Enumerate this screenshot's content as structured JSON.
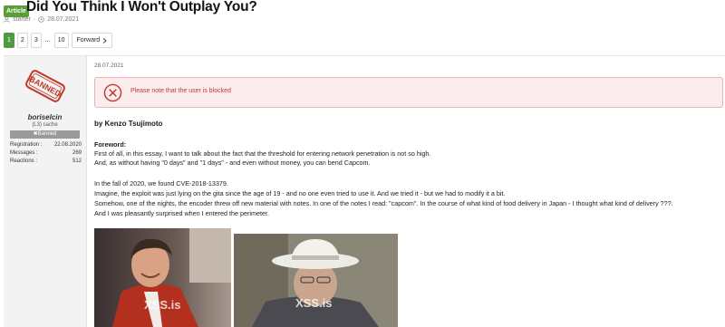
{
  "thread": {
    "badge": "Article",
    "title": "Did You Think I Won't Outplay You?",
    "starter": "starter",
    "date": "28.07.2021"
  },
  "pagination": {
    "pages": [
      "1",
      "2",
      "3",
      "...",
      "10"
    ],
    "active": "1",
    "forward": "Forward"
  },
  "user": {
    "stamp_text": "BANNED",
    "name": "boriselcin",
    "title": "(L3) cache",
    "banner": "Banned",
    "stats": [
      {
        "label": "Registration :",
        "value": "22.08.2020"
      },
      {
        "label": "Messages :",
        "value": "269"
      },
      {
        "label": "Reactions :",
        "value": "512"
      }
    ]
  },
  "post": {
    "date": "28.07.2021",
    "blocked_notice": "Please note that the user is blocked",
    "byline": "by Kenzo Tsujimoto",
    "heading": "Foreword:",
    "lines": [
      "First of all, in this essay, I want to talk about the fact that the threshold for entering network penetration is not so high.",
      "And, as without having \"0 days\" and \"1 days\" - and even without money, you can bend Capcom.",
      "In the fall of 2020, we found CVE-2018-13379.",
      "Imagine, the exploit was just lying on the gita since the age of 19 - and no one even tried to use it. And we tried it - but we had to modify it a bit.",
      "Somehow, one of the nights, the encoder threw off new material with notes. In one of the notes I read: \"capcom\". In the course of what kind of food delivery in Japan - I thought what kind of delivery ???.",
      "And I was pleasantly surprised when I entered the perimeter."
    ],
    "watermark": "XSS.is"
  },
  "colors": {
    "accent_green": "#4f9a43",
    "alert_red": "#c1392b",
    "alert_bg": "#fbeded"
  }
}
